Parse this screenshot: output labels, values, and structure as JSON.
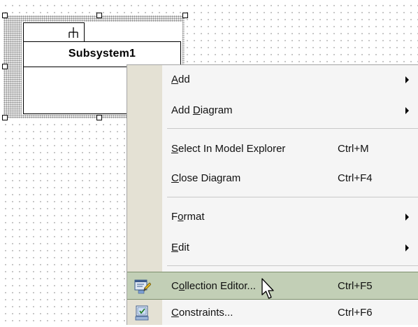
{
  "diagram": {
    "element_name": "Subsystem1",
    "element_icon": "subsystem-fork-icon"
  },
  "context_menu": {
    "items": [
      {
        "label": "Add",
        "accel": "A",
        "rest": "dd",
        "shortcut": "",
        "submenu": true
      },
      {
        "label": "Add Diagram",
        "pre": "Add ",
        "accel": "D",
        "rest": "iagram",
        "shortcut": "",
        "submenu": true
      },
      {
        "label": "Select In Model Explorer",
        "accel": "S",
        "rest": "elect In Model Explorer",
        "shortcut": "Ctrl+M",
        "submenu": false
      },
      {
        "label": "Close Diagram",
        "accel": "C",
        "rest": "lose Diagram",
        "shortcut": "Ctrl+F4",
        "submenu": false
      },
      {
        "label": "Format",
        "pre": "F",
        "accel": "o",
        "rest": "rmat",
        "shortcut": "",
        "submenu": true
      },
      {
        "label": "Edit",
        "accel": "E",
        "rest": "dit",
        "shortcut": "",
        "submenu": true
      },
      {
        "label": "Collection Editor...",
        "pre": "C",
        "accel": "o",
        "rest": "llection Editor...",
        "shortcut": "Ctrl+F5",
        "submenu": false,
        "icon": "collection-editor-icon",
        "highlighted": true
      },
      {
        "label": "Constraints...",
        "accel": "C",
        "rest": "onstraints...",
        "shortcut": "Ctrl+F6",
        "submenu": false,
        "icon": "constraints-icon"
      }
    ]
  },
  "colors": {
    "highlight": "#c2cfb6",
    "gutter": "#e4e1d4",
    "menu_bg": "#f5f5f5"
  }
}
